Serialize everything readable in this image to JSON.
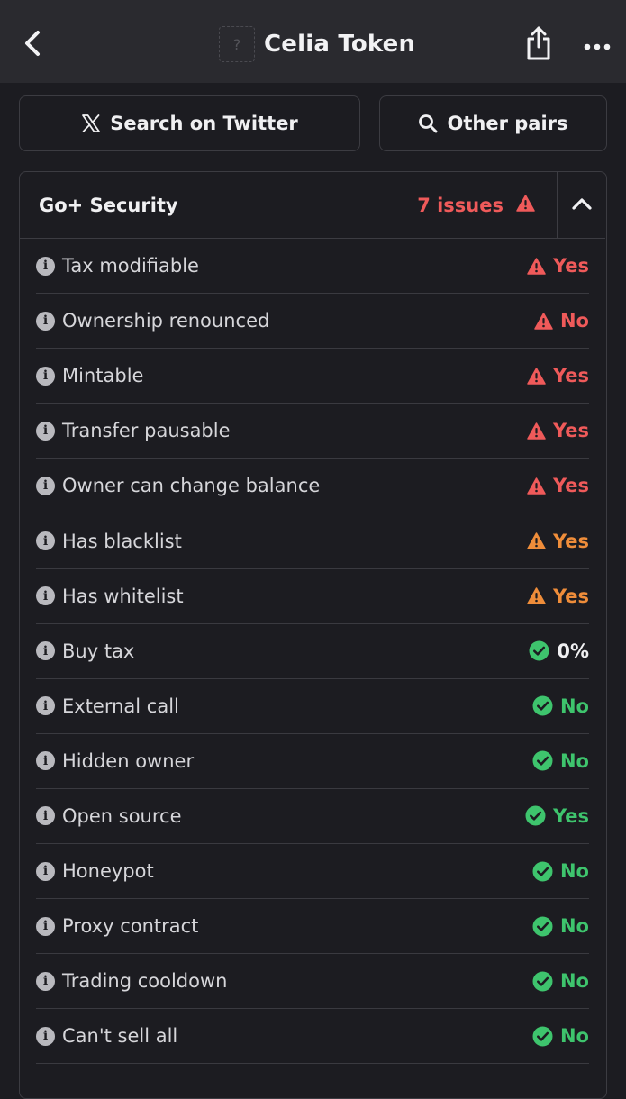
{
  "colors": {
    "danger": "#ef5a5a",
    "warning": "#ef8d3a",
    "success": "#3ec46d",
    "neutral": "#f0f0f2"
  },
  "header": {
    "title": "Celia Token",
    "logo_placeholder": "?",
    "back_icon": "chevron-left-icon",
    "share_icon": "share-icon",
    "more_icon": "more-horizontal-icon"
  },
  "actions": {
    "twitter_label": "Search on Twitter",
    "twitter_icon": "x-logo-icon",
    "pairs_label": "Other pairs",
    "pairs_icon": "search-icon"
  },
  "security": {
    "title": "Go+ Security",
    "issues_label": "7 issues",
    "issues_icon": "warning-icon",
    "collapse_icon": "chevron-up-icon",
    "rows": [
      {
        "label": "Tax modifiable",
        "value": "Yes",
        "status": "danger"
      },
      {
        "label": "Ownership renounced",
        "value": "No",
        "status": "danger"
      },
      {
        "label": "Mintable",
        "value": "Yes",
        "status": "danger"
      },
      {
        "label": "Transfer pausable",
        "value": "Yes",
        "status": "danger"
      },
      {
        "label": "Owner can change balance",
        "value": "Yes",
        "status": "danger"
      },
      {
        "label": "Has blacklist",
        "value": "Yes",
        "status": "warning"
      },
      {
        "label": "Has whitelist",
        "value": "Yes",
        "status": "warning"
      },
      {
        "label": "Buy tax",
        "value": "0%",
        "status": "success",
        "value_color": "neutral"
      },
      {
        "label": "External call",
        "value": "No",
        "status": "success"
      },
      {
        "label": "Hidden owner",
        "value": "No",
        "status": "success"
      },
      {
        "label": "Open source",
        "value": "Yes",
        "status": "success"
      },
      {
        "label": "Honeypot",
        "value": "No",
        "status": "success"
      },
      {
        "label": "Proxy contract",
        "value": "No",
        "status": "success"
      },
      {
        "label": "Trading cooldown",
        "value": "No",
        "status": "success"
      },
      {
        "label": "Can't sell all",
        "value": "No",
        "status": "success"
      }
    ]
  }
}
